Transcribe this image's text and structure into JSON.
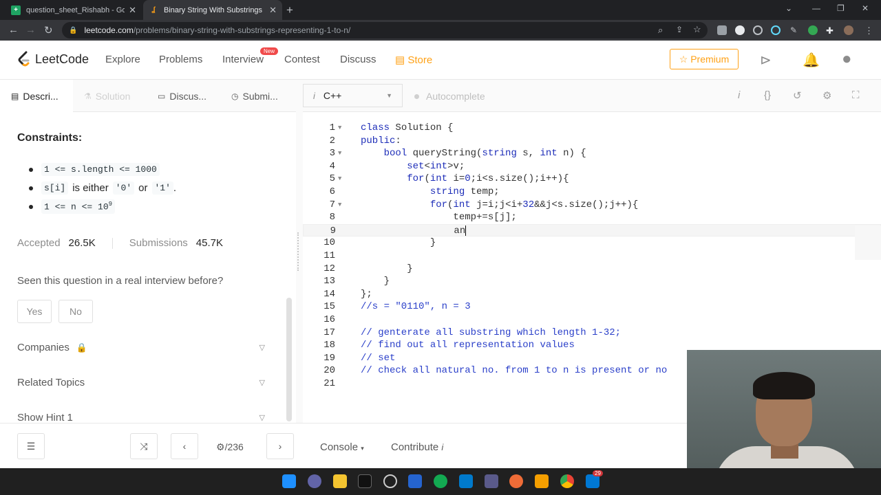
{
  "browser": {
    "tabs": [
      {
        "title": "question_sheet_Rishabh - Googl",
        "favicon": "sheets-icon",
        "active": false
      },
      {
        "title": "Binary String With Substrings Rep",
        "favicon": "leetcode-icon",
        "active": true
      }
    ],
    "url_domain": "leetcode.com",
    "url_path": "/problems/binary-string-with-substrings-representing-1-to-n/"
  },
  "header": {
    "logo_text": "LeetCode",
    "nav": [
      "Explore",
      "Problems",
      "Interview",
      "Contest",
      "Discuss",
      "Store"
    ],
    "interview_badge": "New",
    "premium_label": "Premium",
    "accent": "#ffa116"
  },
  "left_tabs": [
    "Descri...",
    "Solution",
    "Discus...",
    "Submi..."
  ],
  "description": {
    "constraints_heading": "Constraints:",
    "c1_code": "1 <= s.length <= 1000",
    "c2_code1": "s[i]",
    "c2_text": "is either",
    "c2_code2": "'0'",
    "c2_or": "or",
    "c2_code3": "'1'",
    "c2_end": ".",
    "c3_code": "1 <= n <= 10",
    "c3_sup": "9",
    "accepted_label": "Accepted",
    "accepted_value": "26.5K",
    "submissions_label": "Submissions",
    "submissions_value": "45.7K",
    "seen_question": "Seen this question in a real interview before?",
    "yes": "Yes",
    "no": "No",
    "companies": "Companies",
    "related_topics": "Related Topics",
    "show_hint": "Show Hint 1"
  },
  "editor": {
    "language": "C++",
    "autocomplete": "Autocomplete",
    "lines": [
      "class Solution {",
      "public:",
      "    bool queryString(string s, int n) {",
      "        set<int>v;",
      "        for(int i=0;i<s.size();i++){",
      "            string temp;",
      "            for(int j=i;j<i+32&&j<s.size();j++){",
      "                temp+=s[j];",
      "                an",
      "            }",
      "",
      "        }",
      "    }",
      "};",
      "//s = \"0110\", n = 3",
      "",
      "// genterate all substring which length 1-32;",
      "// find out all representation values",
      "// set",
      "// check all natural no. from 1 to n is present or no",
      ""
    ],
    "line_numbers": [
      "1",
      "2",
      "3",
      "4",
      "5",
      "6",
      "7",
      "8",
      "9",
      "10",
      "11",
      "12",
      "13",
      "14",
      "15",
      "16",
      "17",
      "18",
      "19",
      "20",
      "21"
    ]
  },
  "footer": {
    "page_counter": "/236",
    "console": "Console",
    "contribute": "Contribute"
  },
  "taskbar": {
    "chrome_badge": "29"
  }
}
